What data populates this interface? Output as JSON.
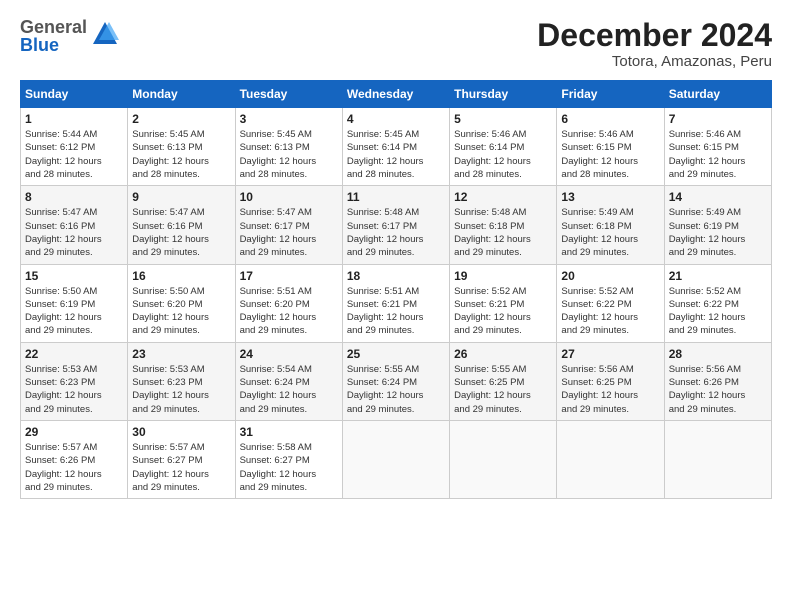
{
  "header": {
    "logo_general": "General",
    "logo_blue": "Blue",
    "title": "December 2024",
    "subtitle": "Totora, Amazonas, Peru"
  },
  "calendar": {
    "days_of_week": [
      "Sunday",
      "Monday",
      "Tuesday",
      "Wednesday",
      "Thursday",
      "Friday",
      "Saturday"
    ],
    "weeks": [
      [
        {
          "day": "",
          "info": ""
        },
        {
          "day": "2",
          "info": "Sunrise: 5:45 AM\nSunset: 6:13 PM\nDaylight: 12 hours\nand 28 minutes."
        },
        {
          "day": "3",
          "info": "Sunrise: 5:45 AM\nSunset: 6:13 PM\nDaylight: 12 hours\nand 28 minutes."
        },
        {
          "day": "4",
          "info": "Sunrise: 5:45 AM\nSunset: 6:14 PM\nDaylight: 12 hours\nand 28 minutes."
        },
        {
          "day": "5",
          "info": "Sunrise: 5:46 AM\nSunset: 6:14 PM\nDaylight: 12 hours\nand 28 minutes."
        },
        {
          "day": "6",
          "info": "Sunrise: 5:46 AM\nSunset: 6:15 PM\nDaylight: 12 hours\nand 28 minutes."
        },
        {
          "day": "7",
          "info": "Sunrise: 5:46 AM\nSunset: 6:15 PM\nDaylight: 12 hours\nand 29 minutes."
        }
      ],
      [
        {
          "day": "8",
          "info": "Sunrise: 5:47 AM\nSunset: 6:16 PM\nDaylight: 12 hours\nand 29 minutes."
        },
        {
          "day": "9",
          "info": "Sunrise: 5:47 AM\nSunset: 6:16 PM\nDaylight: 12 hours\nand 29 minutes."
        },
        {
          "day": "10",
          "info": "Sunrise: 5:47 AM\nSunset: 6:17 PM\nDaylight: 12 hours\nand 29 minutes."
        },
        {
          "day": "11",
          "info": "Sunrise: 5:48 AM\nSunset: 6:17 PM\nDaylight: 12 hours\nand 29 minutes."
        },
        {
          "day": "12",
          "info": "Sunrise: 5:48 AM\nSunset: 6:18 PM\nDaylight: 12 hours\nand 29 minutes."
        },
        {
          "day": "13",
          "info": "Sunrise: 5:49 AM\nSunset: 6:18 PM\nDaylight: 12 hours\nand 29 minutes."
        },
        {
          "day": "14",
          "info": "Sunrise: 5:49 AM\nSunset: 6:19 PM\nDaylight: 12 hours\nand 29 minutes."
        }
      ],
      [
        {
          "day": "15",
          "info": "Sunrise: 5:50 AM\nSunset: 6:19 PM\nDaylight: 12 hours\nand 29 minutes."
        },
        {
          "day": "16",
          "info": "Sunrise: 5:50 AM\nSunset: 6:20 PM\nDaylight: 12 hours\nand 29 minutes."
        },
        {
          "day": "17",
          "info": "Sunrise: 5:51 AM\nSunset: 6:20 PM\nDaylight: 12 hours\nand 29 minutes."
        },
        {
          "day": "18",
          "info": "Sunrise: 5:51 AM\nSunset: 6:21 PM\nDaylight: 12 hours\nand 29 minutes."
        },
        {
          "day": "19",
          "info": "Sunrise: 5:52 AM\nSunset: 6:21 PM\nDaylight: 12 hours\nand 29 minutes."
        },
        {
          "day": "20",
          "info": "Sunrise: 5:52 AM\nSunset: 6:22 PM\nDaylight: 12 hours\nand 29 minutes."
        },
        {
          "day": "21",
          "info": "Sunrise: 5:52 AM\nSunset: 6:22 PM\nDaylight: 12 hours\nand 29 minutes."
        }
      ],
      [
        {
          "day": "22",
          "info": "Sunrise: 5:53 AM\nSunset: 6:23 PM\nDaylight: 12 hours\nand 29 minutes."
        },
        {
          "day": "23",
          "info": "Sunrise: 5:53 AM\nSunset: 6:23 PM\nDaylight: 12 hours\nand 29 minutes."
        },
        {
          "day": "24",
          "info": "Sunrise: 5:54 AM\nSunset: 6:24 PM\nDaylight: 12 hours\nand 29 minutes."
        },
        {
          "day": "25",
          "info": "Sunrise: 5:55 AM\nSunset: 6:24 PM\nDaylight: 12 hours\nand 29 minutes."
        },
        {
          "day": "26",
          "info": "Sunrise: 5:55 AM\nSunset: 6:25 PM\nDaylight: 12 hours\nand 29 minutes."
        },
        {
          "day": "27",
          "info": "Sunrise: 5:56 AM\nSunset: 6:25 PM\nDaylight: 12 hours\nand 29 minutes."
        },
        {
          "day": "28",
          "info": "Sunrise: 5:56 AM\nSunset: 6:26 PM\nDaylight: 12 hours\nand 29 minutes."
        }
      ],
      [
        {
          "day": "29",
          "info": "Sunrise: 5:57 AM\nSunset: 6:26 PM\nDaylight: 12 hours\nand 29 minutes."
        },
        {
          "day": "30",
          "info": "Sunrise: 5:57 AM\nSunset: 6:27 PM\nDaylight: 12 hours\nand 29 minutes."
        },
        {
          "day": "31",
          "info": "Sunrise: 5:58 AM\nSunset: 6:27 PM\nDaylight: 12 hours\nand 29 minutes."
        },
        {
          "day": "",
          "info": ""
        },
        {
          "day": "",
          "info": ""
        },
        {
          "day": "",
          "info": ""
        },
        {
          "day": "",
          "info": ""
        }
      ]
    ],
    "first_day": {
      "day": "1",
      "info": "Sunrise: 5:44 AM\nSunset: 6:12 PM\nDaylight: 12 hours\nand 28 minutes."
    }
  }
}
